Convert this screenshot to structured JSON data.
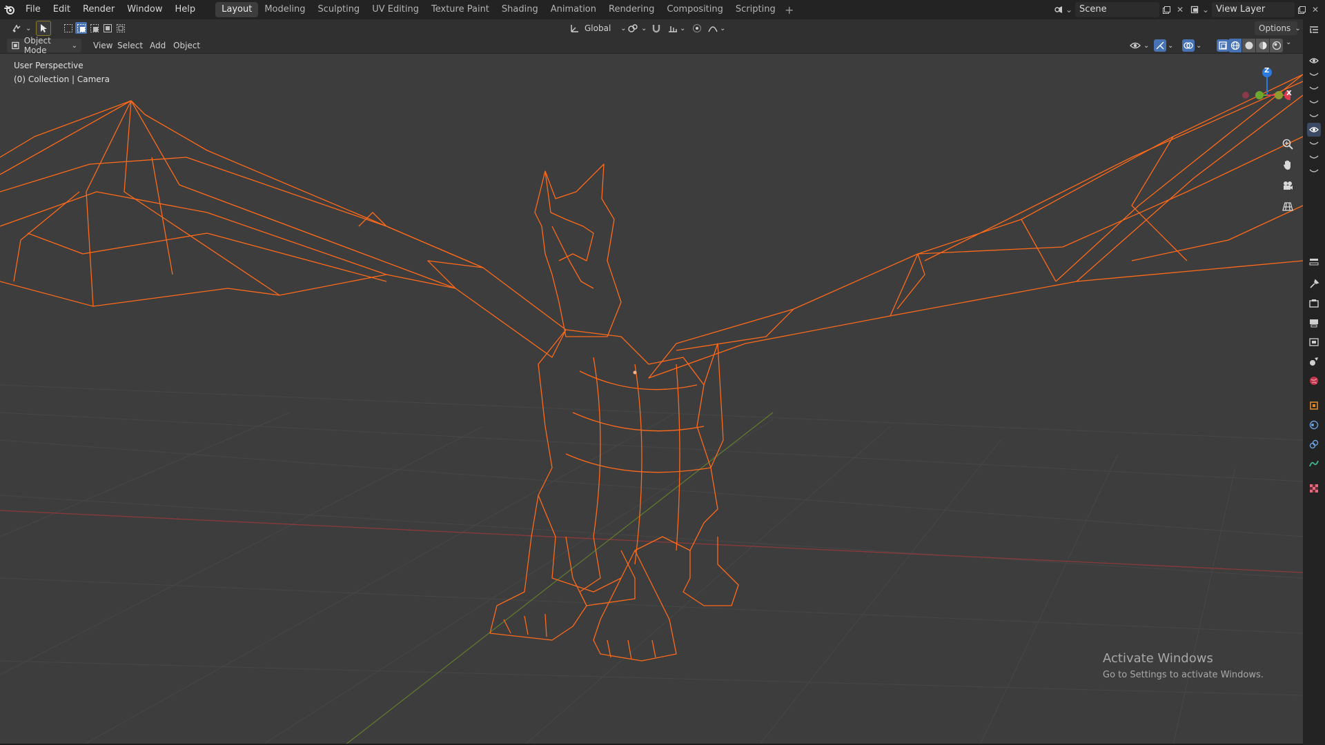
{
  "menu": {
    "items": [
      "File",
      "Edit",
      "Render",
      "Window",
      "Help"
    ]
  },
  "workspaces": {
    "tabs": [
      "Layout",
      "Modeling",
      "Sculpting",
      "UV Editing",
      "Texture Paint",
      "Shading",
      "Animation",
      "Rendering",
      "Compositing",
      "Scripting"
    ],
    "active": "Layout"
  },
  "scene": {
    "label": "Scene"
  },
  "view_layer": {
    "label": "View Layer"
  },
  "toolbar": {
    "transform_orientation": "Global",
    "options_label": "Options"
  },
  "viewport_header": {
    "mode": "Object Mode",
    "menus": [
      "View",
      "Select",
      "Add",
      "Object"
    ]
  },
  "viewport": {
    "perspective_label": "User Perspective",
    "collection_label": "(0) Collection | Camera",
    "gizmo_axes": {
      "z": "Z",
      "x": "X"
    }
  },
  "colors": {
    "wireframe": "#ff6a1a",
    "grid_x_axis": "#8a3a3a",
    "grid_y_axis": "#5e7a2e",
    "viewport_bg": "#3d3d3d",
    "header_bg": "#303030",
    "topbar_bg": "#232323",
    "axis_x": "#e03a4e",
    "axis_y": "#6ea72e",
    "axis_z": "#2e7be0"
  },
  "watermark": {
    "title": "Activate Windows",
    "subtitle": "Go to Settings to activate Windows."
  }
}
